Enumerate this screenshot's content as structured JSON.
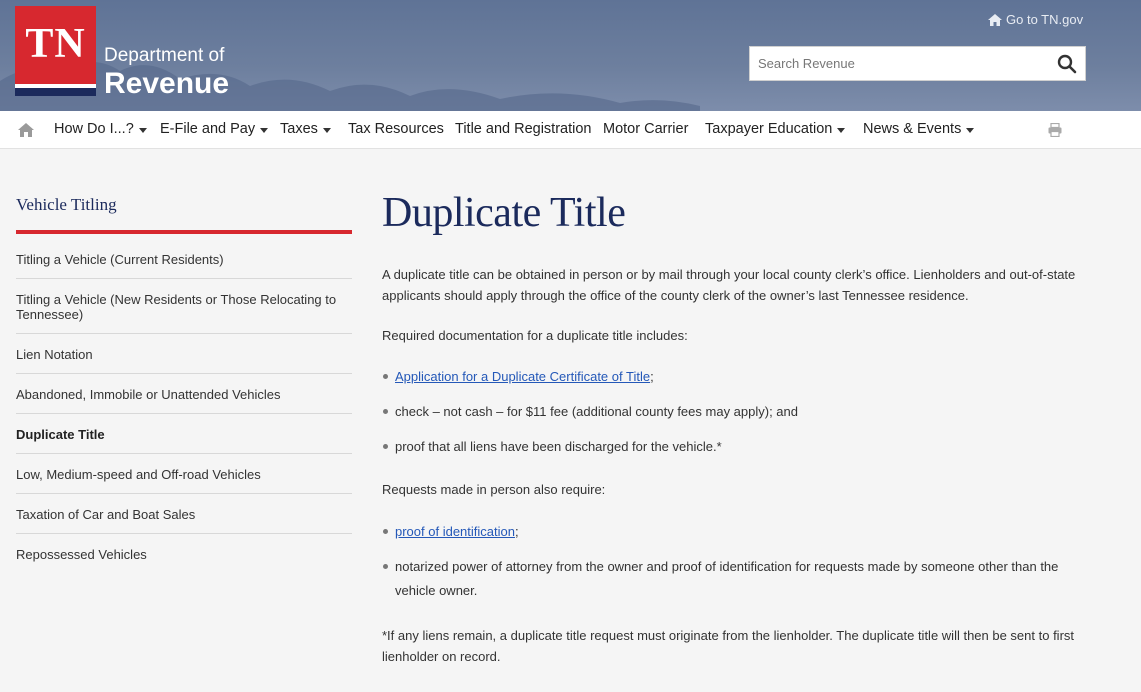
{
  "header": {
    "logo_text": "TN",
    "dept_line": "Department of",
    "revenue_line": "Revenue",
    "goto_link": "Go to TN.gov",
    "search_placeholder": "Search Revenue"
  },
  "nav": {
    "items": [
      {
        "label": "How Do I...?",
        "dropdown": true
      },
      {
        "label": "E-File and Pay",
        "dropdown": true
      },
      {
        "label": "Taxes",
        "dropdown": true
      },
      {
        "label": "Tax Resources",
        "dropdown": false
      },
      {
        "label": "Title and Registration",
        "dropdown": false
      },
      {
        "label": "Motor Carrier",
        "dropdown": false
      },
      {
        "label": "Taxpayer Education",
        "dropdown": true
      },
      {
        "label": "News & Events",
        "dropdown": true
      }
    ]
  },
  "sidebar": {
    "title": "Vehicle Titling",
    "items": [
      {
        "label": "Titling a Vehicle (Current Residents)"
      },
      {
        "label": "Titling a Vehicle (New Residents or Those Relocating to Tennessee)"
      },
      {
        "label": "Lien Notation"
      },
      {
        "label": "Abandoned, Immobile or Unattended Vehicles"
      },
      {
        "label": "Duplicate Title",
        "active": true
      },
      {
        "label": "Low, Medium-speed and Off-road Vehicles"
      },
      {
        "label": "Taxation of Car and Boat Sales"
      },
      {
        "label": "Repossessed Vehicles"
      }
    ]
  },
  "main": {
    "title": "Duplicate Title",
    "intro": "A duplicate title can be obtained in person or by mail through your local county clerk’s office. Lienholders and out-of-state applicants should apply through the office of the county clerk of the owner’s last Tennessee residence.",
    "req_heading": "Required documentation for a duplicate title includes:",
    "req_list": {
      "link1": "Application for a Duplicate Certificate of Title",
      "link1_suffix": ";",
      "item2": "check – not cash – for $11 fee (additional county fees may apply); and",
      "item3": "proof that all liens have been discharged for the vehicle.*"
    },
    "inperson_heading": "Requests made in person also require:",
    "inperson_list": {
      "link1": "proof of identification",
      "link1_suffix": ";",
      "item2": "notarized power of attorney from the owner and proof of identification for requests made by someone other than the vehicle owner."
    },
    "footnote": "*If any liens remain, a duplicate title request must originate from the lienholder. The duplicate title will then be sent to first lienholder on record."
  },
  "colors": {
    "brand_red": "#d7282f",
    "brand_navy": "#1b2a5c",
    "link_blue": "#2458b8"
  }
}
